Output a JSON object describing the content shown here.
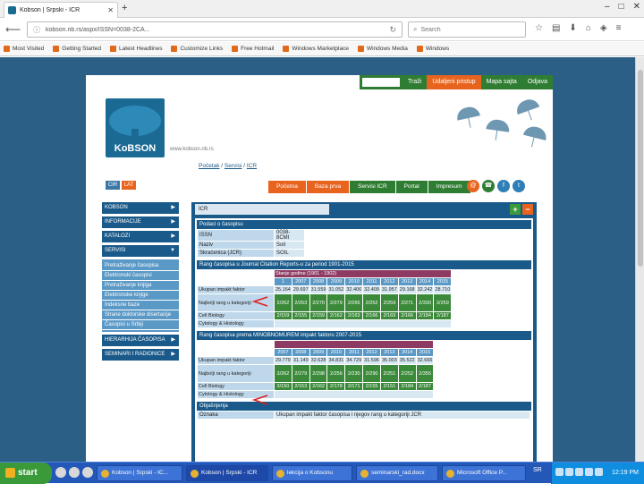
{
  "browser": {
    "tab_title": "Kobson | Srpski - ICR",
    "url": "kobson.nb.rs/aspx/ISSN=0038-2CA...",
    "search_placeholder": "Search",
    "bookmarks": [
      "Most Visited",
      "Getting Started",
      "Latest Headlines",
      "Customize Links",
      "Free Hotmail",
      "Windows Marketplace",
      "Windows Media",
      "Windows"
    ]
  },
  "site": {
    "topnav": [
      "Traži",
      "Udaljeni pristup",
      "Mapa sajta",
      "Odjava"
    ],
    "logo_text": "KoBSON",
    "tagline": "www.kobson.nb.rs",
    "breadcrumb_prefix": "Početak",
    "breadcrumb_mid": "Servisi",
    "breadcrumb_last": "ICR",
    "lang": [
      "CIR",
      "LAT"
    ],
    "menu": [
      "Početna",
      "Baza prva",
      "Servisi ICR",
      "Portal",
      "Impresum"
    ],
    "icon_labels": [
      "@",
      "☎",
      "f",
      "t"
    ],
    "sidebar": {
      "sections": [
        "KOBSON",
        "INFORMACIJE",
        "KATALOZI",
        "SERVISI"
      ],
      "sub_items": [
        "Pretraživanje časopisa",
        "Elektronski časopisi",
        "Pretraživanje knjiga",
        "Elektronske knjige",
        "Indeksne baze",
        "Strane doktorske disertacije",
        "Časopisi u Srbiji"
      ],
      "bottom": [
        "HIERARHIJA ČASOPISA",
        "SEMINARI I RADIONICE"
      ]
    },
    "panel": {
      "header": "ICR",
      "add": "+",
      "minimize": "−",
      "journal_section": "Podaci o časopisu",
      "journal_rows": [
        {
          "key": "ISSN",
          "value": "0038-8CMI"
        },
        {
          "key": "Naziv",
          "value": "Soil"
        },
        {
          "key": "Skraćenica (JCR)",
          "value": "SOIL"
        }
      ],
      "jcr_section": "Rang časopisa u Journal Citation Reports-u za period 1901-2015",
      "jcr_subheader": "Stanje godine (1901 - 1902)",
      "jcr_years": [
        "2007",
        "2008",
        "2009",
        "2010",
        "2011",
        "2012",
        "2013",
        "2014",
        "2015"
      ],
      "jcr_rows": [
        {
          "label": "Ukupan impakt faktor",
          "values": [
            "25.164",
            "29.697",
            "31.559",
            "31.052",
            "32.406",
            "32.409",
            "31.957",
            "29.168",
            "32.242",
            "28.710"
          ]
        },
        {
          "label": "Najbolji rang u kategoriji",
          "values": [
            "2/262",
            "2/253",
            "2/270",
            "2/279",
            "2/265",
            "2/252",
            "2/259",
            "2/271",
            "2/330",
            "2/259"
          ]
        },
        {
          "label": "Cell Biology",
          "values": [
            "2/159",
            "2/155",
            "2/159",
            "2/162",
            "2/163",
            "2/166",
            "2/169",
            "2/166",
            "2/184",
            "2/187"
          ]
        },
        {
          "label": "Cytology & Histology",
          "values": []
        }
      ],
      "m_section": "Rang časopisa prema MINOBNOMUREM impakt faktoru 2007-2015",
      "m_years": [
        "2007",
        "2008",
        "2009",
        "2010",
        "2011",
        "2012",
        "2013",
        "2014",
        "2015"
      ],
      "m_rows": [
        {
          "label": "Ukupan impakt faktor",
          "values": [
            "29.779",
            "31.149",
            "32.628",
            "34.831",
            "34.729",
            "31.596",
            "35.003",
            "35.522",
            "32.666"
          ]
        },
        {
          "label": "Najbolji rang u kategoriji",
          "values": [
            "3/262",
            "2/279",
            "2/298",
            "2/256",
            "2/230",
            "2/290",
            "2/251",
            "2/252",
            "2/355"
          ]
        },
        {
          "label": "Cell Biology",
          "values": [
            "3/150",
            "2/153",
            "2/162",
            "2/178",
            "2/171",
            "2/155",
            "2/151",
            "2/184",
            "2/187"
          ]
        },
        {
          "label": "Cytology & Histology",
          "values": []
        }
      ],
      "expl_section": "Objašnjenja",
      "expl_key": "Oznaka",
      "expl_text": "Ukupan impakt faktor časopisa i njegov rang u kategoriji JCR"
    }
  },
  "taskbar": {
    "start": "start",
    "items": [
      "Kobson | Srpski - ICR",
      "Kobson | Srpski - IC...",
      "lekcija o Kobsonu",
      "seminarski_rad.docx",
      "Microsoft Office P..."
    ],
    "lang": "SR",
    "clock": "12:19 PM"
  }
}
